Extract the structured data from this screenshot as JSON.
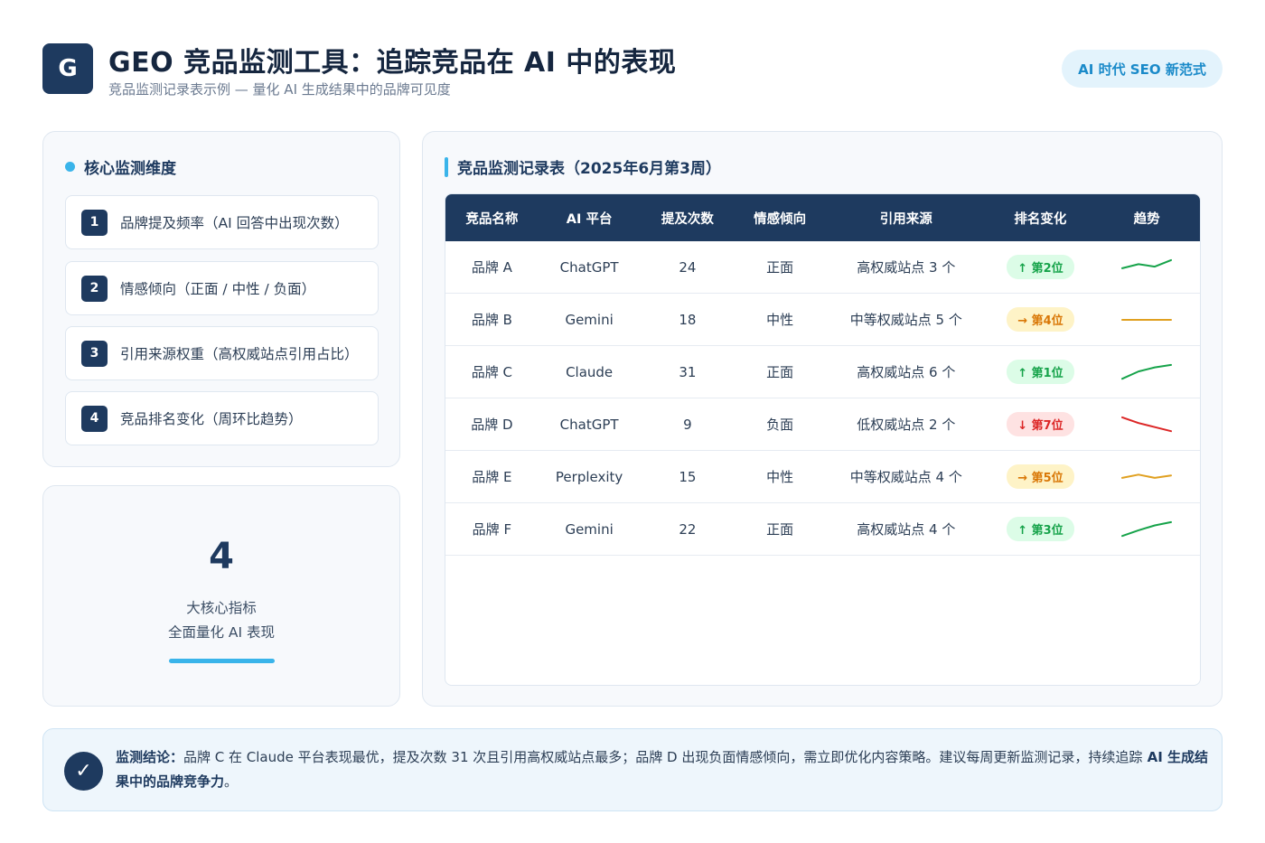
{
  "header": {
    "logo_letter": "G",
    "title": "GEO 竞品监测工具：追踪竞品在 AI 中的表现",
    "subtitle": "竞品监测记录表示例 — 量化 AI 生成结果中的品牌可见度",
    "pill": "AI 时代 SEO 新范式"
  },
  "dimensions": {
    "heading": "核心监测维度",
    "items": [
      {
        "num": "1",
        "label": "品牌提及频率（AI 回答中出现次数）"
      },
      {
        "num": "2",
        "label": "情感倾向（正面 / 中性 / 负面）"
      },
      {
        "num": "3",
        "label": "引用来源权重（高权威站点引用占比）"
      },
      {
        "num": "4",
        "label": "竞品排名变化（周环比趋势）"
      }
    ]
  },
  "stat": {
    "value": "4",
    "line1": "大核心指标",
    "line2": "全面量化 AI 表现"
  },
  "table": {
    "heading": "竞品监测记录表（2025年6月第3周）",
    "columns": [
      "竞品名称",
      "AI 平台",
      "提及次数",
      "情感倾向",
      "引用来源",
      "排名变化",
      "趋势"
    ],
    "rows": [
      {
        "name": "品牌 A",
        "platform": "ChatGPT",
        "mentions": "24",
        "sentiment": "正面",
        "source": "高权威站点 3 个",
        "rank": "↑ 第2位",
        "dir": "up",
        "trend": [
          0.45,
          0.7,
          0.55,
          0.95
        ]
      },
      {
        "name": "品牌 B",
        "platform": "Gemini",
        "mentions": "18",
        "sentiment": "中性",
        "source": "中等权威站点 5 个",
        "rank": "→ 第4位",
        "dir": "flat",
        "trend": [
          0.5,
          0.5,
          0.5,
          0.5
        ]
      },
      {
        "name": "品牌 C",
        "platform": "Claude",
        "mentions": "31",
        "sentiment": "正面",
        "source": "高权威站点 6 个",
        "rank": "↑ 第1位",
        "dir": "up",
        "trend": [
          0.1,
          0.55,
          0.8,
          0.95
        ]
      },
      {
        "name": "品牌 D",
        "platform": "ChatGPT",
        "mentions": "9",
        "sentiment": "负面",
        "source": "低权威站点 2 个",
        "rank": "↓ 第7位",
        "dir": "down",
        "trend": [
          0.95,
          0.6,
          0.35,
          0.1
        ]
      },
      {
        "name": "品牌 E",
        "platform": "Perplexity",
        "mentions": "15",
        "sentiment": "中性",
        "source": "中等权威站点 4 个",
        "rank": "→ 第5位",
        "dir": "flat",
        "trend": [
          0.45,
          0.65,
          0.45,
          0.6
        ]
      },
      {
        "name": "品牌 F",
        "platform": "Gemini",
        "mentions": "22",
        "sentiment": "正面",
        "source": "高权威站点 4 个",
        "rank": "↑ 第3位",
        "dir": "up",
        "trend": [
          0.1,
          0.45,
          0.75,
          0.95
        ]
      }
    ]
  },
  "conclusion": {
    "label": "监测结论：",
    "text": "品牌 C 在 Claude 平台表现最优，提及次数 31 次且引用高权威站点最多；品牌 D 出现负面情感倾向，需立即优化内容策略。建议每周更新监测记录，持续追踪",
    "bold_tail": " AI 生成结果中的品牌竞争力",
    "end": "。"
  },
  "colors": {
    "primary": "#1e3a5f",
    "accent": "#3ab4ea",
    "up": "#16a34a",
    "flat": "#e0a020",
    "down": "#dc2626"
  }
}
